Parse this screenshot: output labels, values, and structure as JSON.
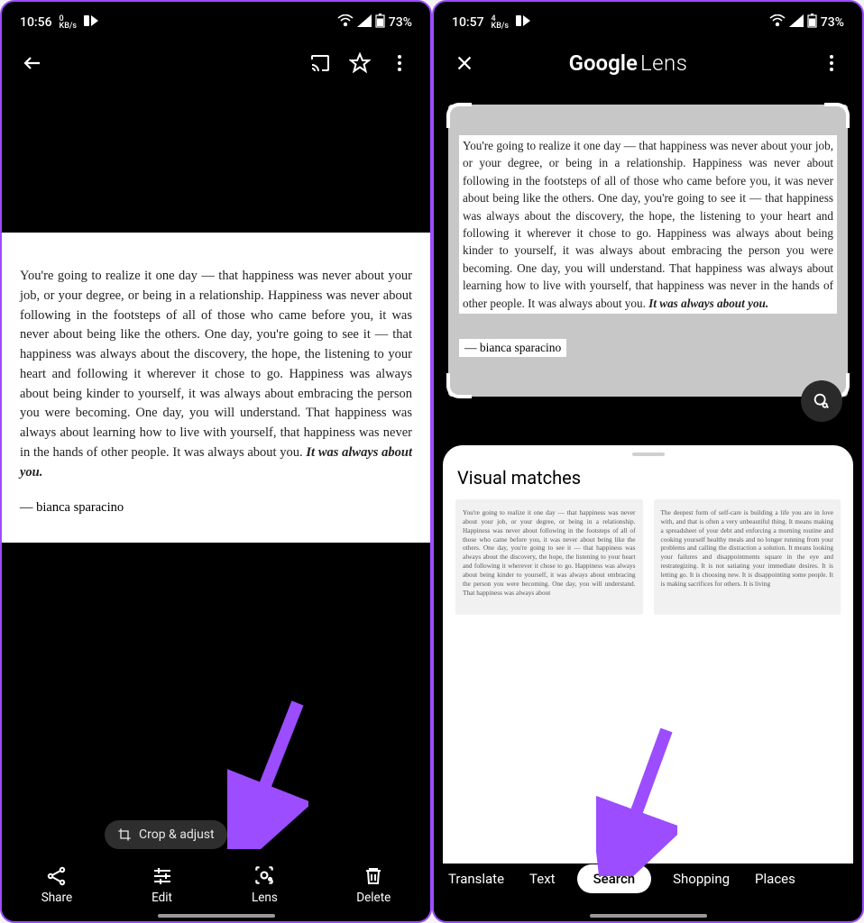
{
  "left": {
    "status": {
      "time": "10:56",
      "speed_num": "0",
      "speed_unit": "KB/s",
      "battery": "73%"
    },
    "quote_plain": "You're going to realize it one day  — that happiness was never about your job, or your degree, or being in a relationship. Happiness was never about following in the footsteps of all of those who came before you, it was never about being like the others. One day, you're going to see it — that happiness was always about the discovery, the hope, the listening to your heart and following it wherever it chose to go. Happiness was always about being kinder to yourself, it was always about embracing the person you were becoming. One day, you will understand. That happiness was always about learning how to live with yourself, that happiness was never in the hands of other people. It was always about you. ",
    "quote_emph": "It was always about you.",
    "quote_author": "— bianca sparacino",
    "crop_label": "Crop & adjust",
    "actions": {
      "share": "Share",
      "edit": "Edit",
      "lens": "Lens",
      "delete": "Delete"
    }
  },
  "right": {
    "status": {
      "time": "10:57",
      "speed_num": "4",
      "speed_unit": "KB/s",
      "battery": "73%"
    },
    "title_google": "Google",
    "title_lens": "Lens",
    "quote_plain": "You're going to realize it one day  — that happiness was never about your job, or your degree, or being in a relationship. Happiness was never about following in the footsteps of all of those who came before you, it was never about being like the others. One day, you're going to see it — that happiness was always about the discovery, the hope, the listening to your heart and following it wherever it chose to go. Happiness was always about being kinder to yourself, it was always about embracing the person you were becoming. One day, you will understand. That happiness was always about learning how to live with yourself, that happiness was never in the hands of other people. It was always about you. ",
    "quote_emph": "It was always about you.",
    "quote_author": "— bianca sparacino",
    "sheet_title": "Visual matches",
    "match1": "You're going to realize it one day — that happiness was never about your job, or your degree, or being in a relationship. Happiness was never about following in the footsteps of all of those who came before you, it was never about being like the others. One day, you're going to see it — that happiness was always about the discovery, the hope, the listening to your heart and following it wherever it chose to go. Happiness was always about being kinder to yourself, it was always about embracing the person you were becoming. One day, you will understand. That happiness was always about",
    "match2": "The deepest form of self-care is building a life you are in love with, and that is often a very unbeautiful thing. It means making a spreadsheet of your debt and enforcing a morning routine and cooking yourself healthy meals and no longer running from your problems and calling the distraction a solution. It means looking your failures and disappointments square in the eye and restrategizing. It is not satiating your immediate desires. It is letting go. It is choosing new. It is disappointing some people. It is making sacrifices for others. It is living",
    "tabs": {
      "translate": "Translate",
      "text": "Text",
      "search": "Search",
      "shopping": "Shopping",
      "places": "Places"
    }
  },
  "colors": {
    "arrow": "#9b4dff"
  }
}
